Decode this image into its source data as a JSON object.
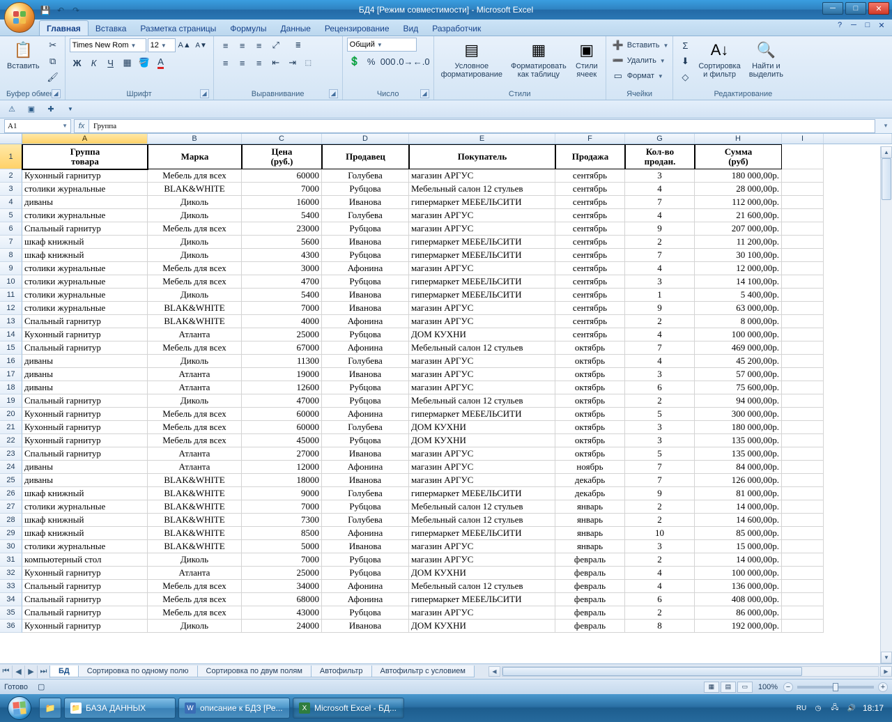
{
  "window": {
    "title": "БД4  [Режим совместимости] - Microsoft Excel"
  },
  "ribbon_tabs": [
    "Главная",
    "Вставка",
    "Разметка страницы",
    "Формулы",
    "Данные",
    "Рецензирование",
    "Вид",
    "Разработчик"
  ],
  "active_tab_index": 0,
  "font": {
    "name": "Times New Rom",
    "size": "12"
  },
  "number_format": "Общий",
  "groups": {
    "paste": "Вставить",
    "clipboard": "Буфер обмена",
    "font": "Шрифт",
    "alignment": "Выравнивание",
    "number": "Число",
    "styles": "Стили",
    "cf": "Условное\nформатирование",
    "ft": "Форматировать\nкак таблицу",
    "cs": "Стили\nячеек",
    "cells": "Ячейки",
    "insert": "Вставить",
    "delete": "Удалить",
    "format": "Формат",
    "editing": "Редактирование",
    "sort": "Сортировка\nи фильтр",
    "find": "Найти и\nвыделить"
  },
  "namebox": "A1",
  "formula": "Группа",
  "columns": [
    "A",
    "B",
    "C",
    "D",
    "E",
    "F",
    "G",
    "H",
    "I"
  ],
  "headers": [
    "Группа\nтовара",
    "Марка",
    "Цена\n(руб.)",
    "Продавец",
    "Покупатель",
    "Продажа",
    "Кол-во\nпродан.",
    "Сумма\n(руб)"
  ],
  "rows": [
    [
      "Кухонный гарнитур",
      "Мебель для всех",
      "60000",
      "Голубева",
      "магазин АРГУС",
      "сентябрь",
      "3",
      "180 000,00р."
    ],
    [
      "столики журнальные",
      "BLAK&WHITE",
      "7000",
      "Рубцова",
      "Мебельный салон 12 стульев",
      "сентябрь",
      "4",
      "28 000,00р."
    ],
    [
      "диваны",
      "Диколь",
      "16000",
      "Иванова",
      "гипермаркет МЕБЕЛЬСИТИ",
      "сентябрь",
      "7",
      "112 000,00р."
    ],
    [
      "столики журнальные",
      "Диколь",
      "5400",
      "Голубева",
      "магазин АРГУС",
      "сентябрь",
      "4",
      "21 600,00р."
    ],
    [
      "Спальный гарнитур",
      "Мебель для всех",
      "23000",
      "Рубцова",
      "магазин АРГУС",
      "сентябрь",
      "9",
      "207 000,00р."
    ],
    [
      "шкаф книжный",
      "Диколь",
      "5600",
      "Иванова",
      "гипермаркет МЕБЕЛЬСИТИ",
      "сентябрь",
      "2",
      "11 200,00р."
    ],
    [
      "шкаф книжный",
      "Диколь",
      "4300",
      "Рубцова",
      "гипермаркет МЕБЕЛЬСИТИ",
      "сентябрь",
      "7",
      "30 100,00р."
    ],
    [
      "столики журнальные",
      "Мебель для всех",
      "3000",
      "Афонина",
      "магазин АРГУС",
      "сентябрь",
      "4",
      "12 000,00р."
    ],
    [
      "столики журнальные",
      "Мебель для всех",
      "4700",
      "Рубцова",
      "гипермаркет МЕБЕЛЬСИТИ",
      "сентябрь",
      "3",
      "14 100,00р."
    ],
    [
      "столики журнальные",
      "Диколь",
      "5400",
      "Иванова",
      "гипермаркет МЕБЕЛЬСИТИ",
      "сентябрь",
      "1",
      "5 400,00р."
    ],
    [
      "столики журнальные",
      "BLAK&WHITE",
      "7000",
      "Иванова",
      "магазин АРГУС",
      "сентябрь",
      "9",
      "63 000,00р."
    ],
    [
      "Спальный гарнитур",
      "BLAK&WHITE",
      "4000",
      "Афонина",
      "магазин АРГУС",
      "сентябрь",
      "2",
      "8 000,00р."
    ],
    [
      "Кухонный гарнитур",
      "Атланта",
      "25000",
      "Рубцова",
      "ДОМ КУХНИ",
      "сентябрь",
      "4",
      "100 000,00р."
    ],
    [
      "Спальный гарнитур",
      "Мебель для всех",
      "67000",
      "Афонина",
      "Мебельный салон 12 стульев",
      "октябрь",
      "7",
      "469 000,00р."
    ],
    [
      "диваны",
      "Диколь",
      "11300",
      "Голубева",
      "магазин АРГУС",
      "октябрь",
      "4",
      "45 200,00р."
    ],
    [
      "диваны",
      "Атланта",
      "19000",
      "Иванова",
      "магазин АРГУС",
      "октябрь",
      "3",
      "57 000,00р."
    ],
    [
      "диваны",
      "Атланта",
      "12600",
      "Рубцова",
      "магазин АРГУС",
      "октябрь",
      "6",
      "75 600,00р."
    ],
    [
      "Спальный гарнитур",
      "Диколь",
      "47000",
      "Рубцова",
      "Мебельный салон 12 стульев",
      "октябрь",
      "2",
      "94 000,00р."
    ],
    [
      "Кухонный гарнитур",
      "Мебель для всех",
      "60000",
      "Афонина",
      "гипермаркет МЕБЕЛЬСИТИ",
      "октябрь",
      "5",
      "300 000,00р."
    ],
    [
      "Кухонный гарнитур",
      "Мебель для всех",
      "60000",
      "Голубева",
      "ДОМ КУХНИ",
      "октябрь",
      "3",
      "180 000,00р."
    ],
    [
      "Кухонный гарнитур",
      "Мебель для всех",
      "45000",
      "Рубцова",
      "ДОМ КУХНИ",
      "октябрь",
      "3",
      "135 000,00р."
    ],
    [
      "Спальный гарнитур",
      "Атланта",
      "27000",
      "Иванова",
      "магазин АРГУС",
      "октябрь",
      "5",
      "135 000,00р."
    ],
    [
      "диваны",
      "Атланта",
      "12000",
      "Афонина",
      "магазин АРГУС",
      "ноябрь",
      "7",
      "84 000,00р."
    ],
    [
      "диваны",
      "BLAK&WHITE",
      "18000",
      "Иванова",
      "магазин АРГУС",
      "декабрь",
      "7",
      "126 000,00р."
    ],
    [
      "шкаф книжный",
      "BLAK&WHITE",
      "9000",
      "Голубева",
      "гипермаркет МЕБЕЛЬСИТИ",
      "декабрь",
      "9",
      "81 000,00р."
    ],
    [
      "столики журнальные",
      "BLAK&WHITE",
      "7000",
      "Рубцова",
      "Мебельный салон 12 стульев",
      "январь",
      "2",
      "14 000,00р."
    ],
    [
      "шкаф книжный",
      "BLAK&WHITE",
      "7300",
      "Голубева",
      "Мебельный салон 12 стульев",
      "январь",
      "2",
      "14 600,00р."
    ],
    [
      "шкаф книжный",
      "BLAK&WHITE",
      "8500",
      "Афонина",
      "гипермаркет МЕБЕЛЬСИТИ",
      "январь",
      "10",
      "85 000,00р."
    ],
    [
      "столики журнальные",
      "BLAK&WHITE",
      "5000",
      "Иванова",
      "магазин АРГУС",
      "январь",
      "3",
      "15 000,00р."
    ],
    [
      "компьютерный стол",
      "Диколь",
      "7000",
      "Рубцова",
      "магазин АРГУС",
      "февраль",
      "2",
      "14 000,00р."
    ],
    [
      "Кухонный гарнитур",
      "Атланта",
      "25000",
      "Рубцова",
      "ДОМ КУХНИ",
      "февраль",
      "4",
      "100 000,00р."
    ],
    [
      "Спальный гарнитур",
      "Мебель для всех",
      "34000",
      "Афонина",
      "Мебельный салон 12 стульев",
      "февраль",
      "4",
      "136 000,00р."
    ],
    [
      "Спальный гарнитур",
      "Мебель для всех",
      "68000",
      "Афонина",
      "гипермаркет МЕБЕЛЬСИТИ",
      "февраль",
      "6",
      "408 000,00р."
    ],
    [
      "Спальный гарнитур",
      "Мебель для всех",
      "43000",
      "Рубцова",
      "магазин АРГУС",
      "февраль",
      "2",
      "86 000,00р."
    ],
    [
      "Кухонный гарнитур",
      "Диколь",
      "24000",
      "Иванова",
      "ДОМ КУХНИ",
      "февраль",
      "8",
      "192 000,00р."
    ]
  ],
  "sheets": [
    "БД",
    "Сортировка по одному полю",
    "Сортировка по двум полям",
    "Автофильтр",
    "Автофильтр с условием"
  ],
  "active_sheet": 0,
  "status": "Готово",
  "zoom": "100%",
  "lang": "RU",
  "clock": "18:17",
  "task_apps": [
    "БАЗА ДАННЫХ",
    "описание к БДЗ [Ре...",
    "Microsoft Excel - БД..."
  ]
}
